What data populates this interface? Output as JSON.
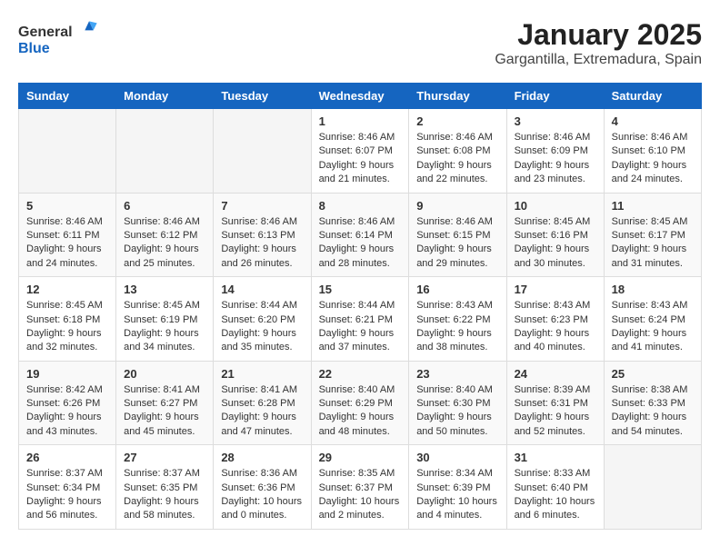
{
  "header": {
    "logo_general": "General",
    "logo_blue": "Blue",
    "title": "January 2025",
    "subtitle": "Gargantilla, Extremadura, Spain"
  },
  "weekdays": [
    "Sunday",
    "Monday",
    "Tuesday",
    "Wednesday",
    "Thursday",
    "Friday",
    "Saturday"
  ],
  "weeks": [
    [
      {
        "day": "",
        "info": ""
      },
      {
        "day": "",
        "info": ""
      },
      {
        "day": "",
        "info": ""
      },
      {
        "day": "1",
        "info": "Sunrise: 8:46 AM\nSunset: 6:07 PM\nDaylight: 9 hours\nand 21 minutes."
      },
      {
        "day": "2",
        "info": "Sunrise: 8:46 AM\nSunset: 6:08 PM\nDaylight: 9 hours\nand 22 minutes."
      },
      {
        "day": "3",
        "info": "Sunrise: 8:46 AM\nSunset: 6:09 PM\nDaylight: 9 hours\nand 23 minutes."
      },
      {
        "day": "4",
        "info": "Sunrise: 8:46 AM\nSunset: 6:10 PM\nDaylight: 9 hours\nand 24 minutes."
      }
    ],
    [
      {
        "day": "5",
        "info": "Sunrise: 8:46 AM\nSunset: 6:11 PM\nDaylight: 9 hours\nand 24 minutes."
      },
      {
        "day": "6",
        "info": "Sunrise: 8:46 AM\nSunset: 6:12 PM\nDaylight: 9 hours\nand 25 minutes."
      },
      {
        "day": "7",
        "info": "Sunrise: 8:46 AM\nSunset: 6:13 PM\nDaylight: 9 hours\nand 26 minutes."
      },
      {
        "day": "8",
        "info": "Sunrise: 8:46 AM\nSunset: 6:14 PM\nDaylight: 9 hours\nand 28 minutes."
      },
      {
        "day": "9",
        "info": "Sunrise: 8:46 AM\nSunset: 6:15 PM\nDaylight: 9 hours\nand 29 minutes."
      },
      {
        "day": "10",
        "info": "Sunrise: 8:45 AM\nSunset: 6:16 PM\nDaylight: 9 hours\nand 30 minutes."
      },
      {
        "day": "11",
        "info": "Sunrise: 8:45 AM\nSunset: 6:17 PM\nDaylight: 9 hours\nand 31 minutes."
      }
    ],
    [
      {
        "day": "12",
        "info": "Sunrise: 8:45 AM\nSunset: 6:18 PM\nDaylight: 9 hours\nand 32 minutes."
      },
      {
        "day": "13",
        "info": "Sunrise: 8:45 AM\nSunset: 6:19 PM\nDaylight: 9 hours\nand 34 minutes."
      },
      {
        "day": "14",
        "info": "Sunrise: 8:44 AM\nSunset: 6:20 PM\nDaylight: 9 hours\nand 35 minutes."
      },
      {
        "day": "15",
        "info": "Sunrise: 8:44 AM\nSunset: 6:21 PM\nDaylight: 9 hours\nand 37 minutes."
      },
      {
        "day": "16",
        "info": "Sunrise: 8:43 AM\nSunset: 6:22 PM\nDaylight: 9 hours\nand 38 minutes."
      },
      {
        "day": "17",
        "info": "Sunrise: 8:43 AM\nSunset: 6:23 PM\nDaylight: 9 hours\nand 40 minutes."
      },
      {
        "day": "18",
        "info": "Sunrise: 8:43 AM\nSunset: 6:24 PM\nDaylight: 9 hours\nand 41 minutes."
      }
    ],
    [
      {
        "day": "19",
        "info": "Sunrise: 8:42 AM\nSunset: 6:26 PM\nDaylight: 9 hours\nand 43 minutes."
      },
      {
        "day": "20",
        "info": "Sunrise: 8:41 AM\nSunset: 6:27 PM\nDaylight: 9 hours\nand 45 minutes."
      },
      {
        "day": "21",
        "info": "Sunrise: 8:41 AM\nSunset: 6:28 PM\nDaylight: 9 hours\nand 47 minutes."
      },
      {
        "day": "22",
        "info": "Sunrise: 8:40 AM\nSunset: 6:29 PM\nDaylight: 9 hours\nand 48 minutes."
      },
      {
        "day": "23",
        "info": "Sunrise: 8:40 AM\nSunset: 6:30 PM\nDaylight: 9 hours\nand 50 minutes."
      },
      {
        "day": "24",
        "info": "Sunrise: 8:39 AM\nSunset: 6:31 PM\nDaylight: 9 hours\nand 52 minutes."
      },
      {
        "day": "25",
        "info": "Sunrise: 8:38 AM\nSunset: 6:33 PM\nDaylight: 9 hours\nand 54 minutes."
      }
    ],
    [
      {
        "day": "26",
        "info": "Sunrise: 8:37 AM\nSunset: 6:34 PM\nDaylight: 9 hours\nand 56 minutes."
      },
      {
        "day": "27",
        "info": "Sunrise: 8:37 AM\nSunset: 6:35 PM\nDaylight: 9 hours\nand 58 minutes."
      },
      {
        "day": "28",
        "info": "Sunrise: 8:36 AM\nSunset: 6:36 PM\nDaylight: 10 hours\nand 0 minutes."
      },
      {
        "day": "29",
        "info": "Sunrise: 8:35 AM\nSunset: 6:37 PM\nDaylight: 10 hours\nand 2 minutes."
      },
      {
        "day": "30",
        "info": "Sunrise: 8:34 AM\nSunset: 6:39 PM\nDaylight: 10 hours\nand 4 minutes."
      },
      {
        "day": "31",
        "info": "Sunrise: 8:33 AM\nSunset: 6:40 PM\nDaylight: 10 hours\nand 6 minutes."
      },
      {
        "day": "",
        "info": ""
      }
    ]
  ]
}
